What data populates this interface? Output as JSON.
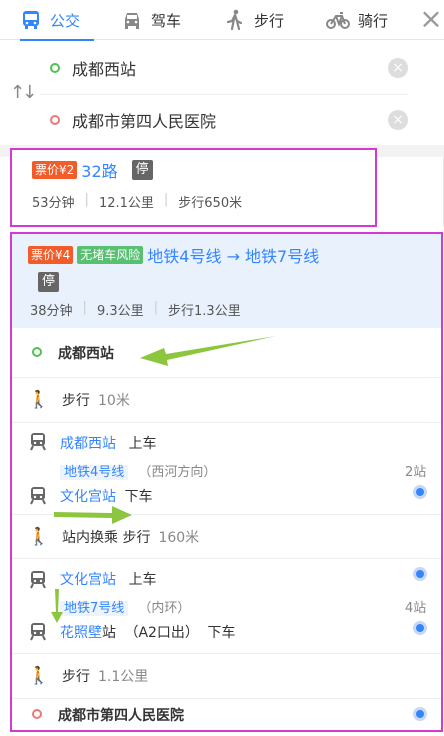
{
  "tabs": [
    {
      "label": "公交",
      "icon": "bus-icon",
      "active": true
    },
    {
      "label": "驾车",
      "icon": "car-icon",
      "active": false
    },
    {
      "label": "步行",
      "icon": "walk-icon",
      "active": false
    },
    {
      "label": "骑行",
      "icon": "bike-icon",
      "active": false
    }
  ],
  "route_inputs": {
    "origin": "成都西站",
    "destination": "成都市第四人民医院"
  },
  "plan1": {
    "price_tag": "票价¥2",
    "route_name": "32路",
    "stop_badge": "停",
    "duration": "53分钟",
    "distance": "12.1公里",
    "walk": "步行650米"
  },
  "plan2": {
    "price_tag": "票价¥4",
    "risk_tag": "无堵车风险",
    "route_name": "地铁4号线 → 地铁7号线",
    "stop_badge": "停",
    "duration": "38分钟",
    "distance": "9.3公里",
    "walk": "步行1.3公里",
    "steps": {
      "start": "成都西站",
      "walk1_label": "步行",
      "walk1_dist": "10米",
      "board1_station": "成都西站",
      "board1_action": "上车",
      "line1": "地铁4号线",
      "line1_dir": "（西河方向）",
      "line1_stops": "2站",
      "alight1_station": "文化宫站",
      "alight1_action": "下车",
      "transfer_label": "站内换乘 步行",
      "transfer_dist": "160米",
      "board2_station": "文化宫站",
      "board2_action": "上车",
      "line2": "地铁7号线",
      "line2_dir": "（内环）",
      "line2_stops": "4站",
      "alight2_station": "花照壁",
      "alight2_suffix": "站",
      "alight2_exit": "（A2口出）",
      "alight2_action": "下车",
      "walk2_label": "步行",
      "walk2_dist": "1.1公里",
      "end": "成都市第四人民医院"
    }
  },
  "colors": {
    "accent": "#3385ff",
    "highlight_box": "#d33ad3",
    "price": "#f25c2a",
    "risk": "#59c071",
    "arrow": "#8cc63f"
  }
}
